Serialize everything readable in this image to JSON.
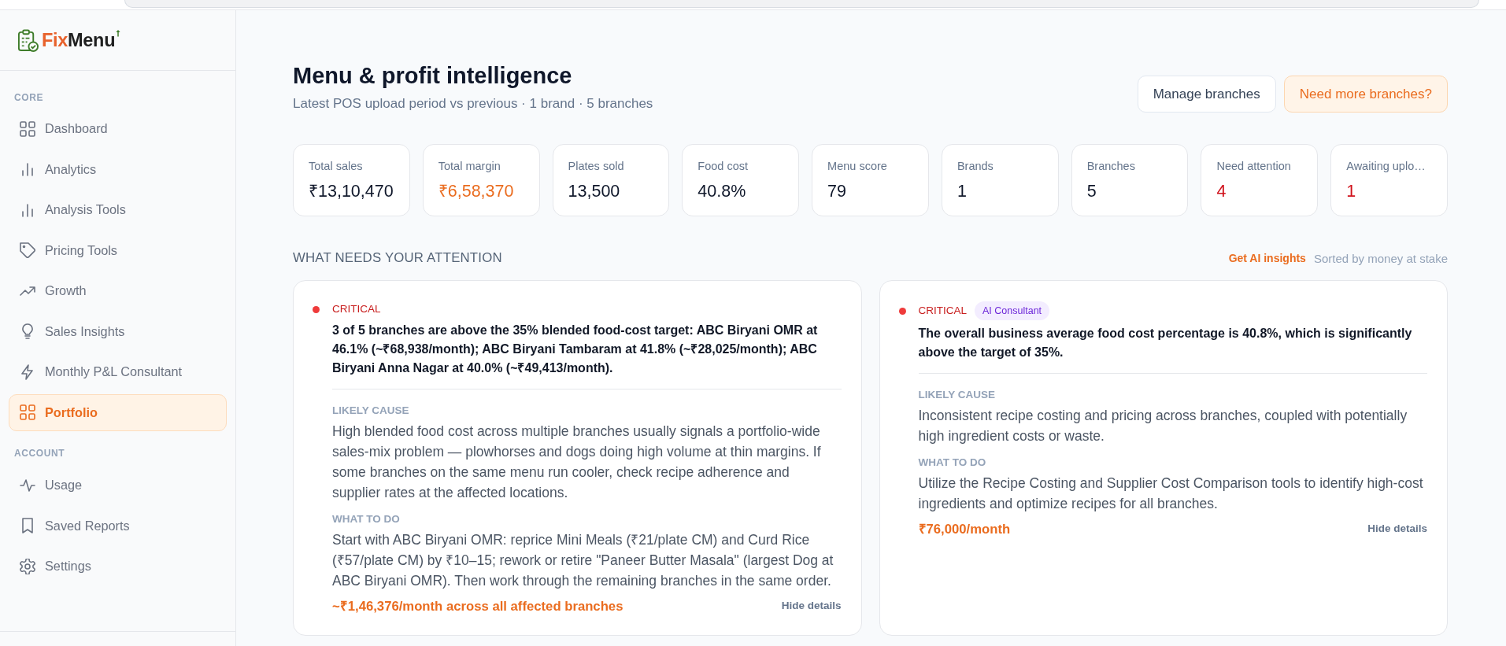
{
  "sidebar": {
    "logo": {
      "first": "Fix",
      "second": "Menu"
    },
    "sections": [
      {
        "title": "CORE",
        "items": [
          {
            "label": "Dashboard",
            "selected": false
          },
          {
            "label": "Analytics",
            "selected": false
          },
          {
            "label": "Analysis Tools",
            "selected": false
          },
          {
            "label": "Pricing Tools",
            "selected": false
          },
          {
            "label": "Growth",
            "selected": false
          },
          {
            "label": "Sales Insights",
            "selected": false
          },
          {
            "label": "Monthly P&L Consultant",
            "selected": false
          },
          {
            "label": "Portfolio",
            "selected": true
          }
        ]
      },
      {
        "title": "ACCOUNT",
        "items": [
          {
            "label": "Usage",
            "selected": false
          },
          {
            "label": "Saved Reports",
            "selected": false
          },
          {
            "label": "Settings",
            "selected": false
          }
        ]
      }
    ]
  },
  "header": {
    "title": "Menu & profit intelligence",
    "subtitle": "Latest POS upload period vs previous · 1 brand · 5 branches",
    "buttons": [
      {
        "label": "Manage branches",
        "kind": "secondary"
      },
      {
        "label": "Need more branches?",
        "kind": "accent"
      }
    ]
  },
  "stats": [
    {
      "label": "Total sales",
      "value": "₹13,10,470",
      "highlighted": false,
      "alert": false
    },
    {
      "label": "Total margin",
      "value": "₹6,58,370",
      "highlighted": true,
      "alert": false
    },
    {
      "label": "Plates sold",
      "value": "13,500",
      "highlighted": false,
      "alert": false
    },
    {
      "label": "Food cost",
      "value": "40.8%",
      "highlighted": false,
      "alert": false
    },
    {
      "label": "Menu score",
      "value": "79",
      "highlighted": false,
      "alert": false
    },
    {
      "label": "Brands",
      "value": "1",
      "highlighted": false,
      "alert": false
    },
    {
      "label": "Branches",
      "value": "5",
      "highlighted": false,
      "alert": false
    },
    {
      "label": "Need attention",
      "value": "4",
      "highlighted": false,
      "alert": true
    },
    {
      "label": "Awaiting uplo…",
      "value": "1",
      "highlighted": false,
      "alert": true
    }
  ],
  "attention": {
    "title": "WHAT NEEDS YOUR ATTENTION",
    "link": "Get AI insights",
    "sort_note": "Sorted by money at stake",
    "cards": [
      {
        "kind": "critical",
        "severity": "CRITICAL",
        "headline": "3 of 5 branches are above the 35% blended food-cost target: ABC Biryani OMR at 46.1% (~₹68,938/month); ABC Biryani Tambaram at 41.8% (~₹28,025/month); ABC Biryani Anna Nagar at 40.0% (~₹49,413/month).",
        "details": [
          {
            "heading": "LIKELY CAUSE",
            "text": "High blended food cost across multiple branches usually signals a portfolio-wide sales-mix problem — plowhorses and dogs doing high volume at thin margins. If some branches on the same menu run cooler, check recipe adherence and supplier rates at the affected locations."
          },
          {
            "heading": "WHAT TO DO",
            "text": "Start with ABC Biryani OMR: reprice Mini Meals (₹21/plate CM) and Curd Rice (₹57/plate CM) by ₹10–15; rework or retire \"Paneer Butter Masala\" (largest Dog at ABC Biryani OMR). Then work through the remaining branches in the same order."
          }
        ],
        "impact": "~₹1,46,376/month across all affected branches",
        "toggle": "Hide details"
      },
      {
        "kind": "critical",
        "severity": "CRITICAL",
        "badge": "AI Consultant",
        "headline": "The overall business average food cost percentage is 40.8%, which is significantly above the target of 35%.",
        "details": [
          {
            "heading": "LIKELY CAUSE",
            "text": "Inconsistent recipe costing and pricing across branches, coupled with potentially high ingredient costs or waste."
          },
          {
            "heading": "WHAT TO DO",
            "text": "Utilize the Recipe Costing and Supplier Cost Comparison tools to identify high-cost ingredients and optimize recipes for all branches."
          }
        ],
        "impact": "₹76,000/month",
        "toggle": "Hide details"
      }
    ]
  }
}
